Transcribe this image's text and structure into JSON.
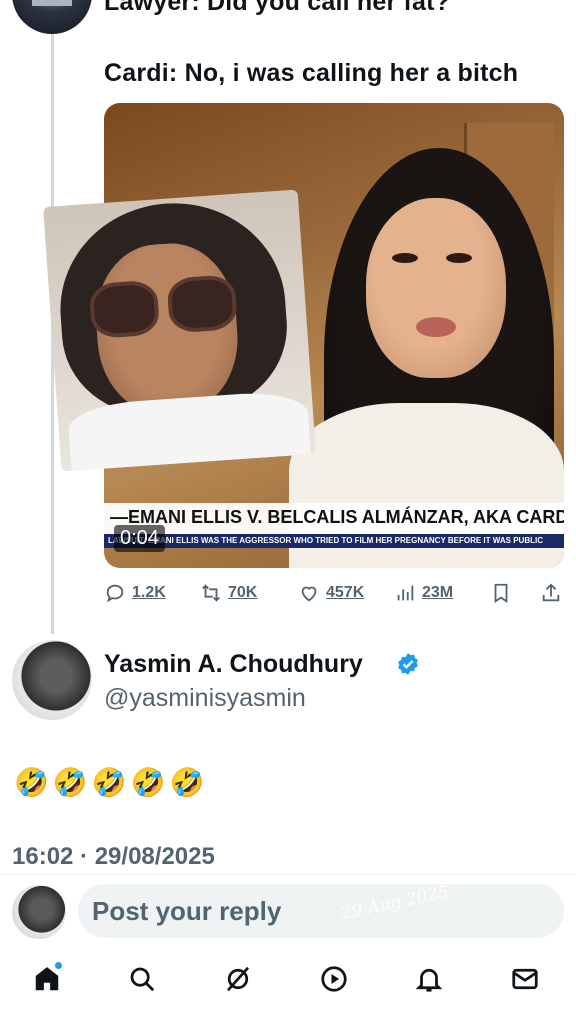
{
  "tweet": {
    "text_line1": "Lawyer: Did you call her fat?",
    "text_line2": "Cardi: No, i was calling her a bitch",
    "video": {
      "caption_title": "—EMANI ELLIS V. BELCALIS ALMÁNZAR, AKA CARDI",
      "caption_sub": "LAWSUIT: EMANI ELLIS WAS THE AGGRESSOR WHO TRIED TO FILM HER PREGNANCY BEFORE IT WAS PUBLIC",
      "duration": "0:04"
    },
    "actions": {
      "replies": "1.2K",
      "retweets": "70K",
      "likes": "457K",
      "views": "23M"
    }
  },
  "reply_tweet": {
    "author_name": "Yasmin A. Choudhury",
    "handle": "@yasminisyasmin",
    "verified": true,
    "emojis": "🤣🤣🤣🤣🤣",
    "timestamp": "16:02 · 29/08/2025"
  },
  "composer": {
    "placeholder": "Post your reply",
    "watermark": "29 Aug 2025"
  },
  "tabbar": {
    "items": [
      "home-icon",
      "search-icon",
      "grok-icon",
      "video-icon",
      "notifications-icon",
      "messages-icon"
    ],
    "active": "home-icon"
  },
  "colors": {
    "accent": "#1d9bf0",
    "text": "#0f1419",
    "secondary": "#536471"
  }
}
